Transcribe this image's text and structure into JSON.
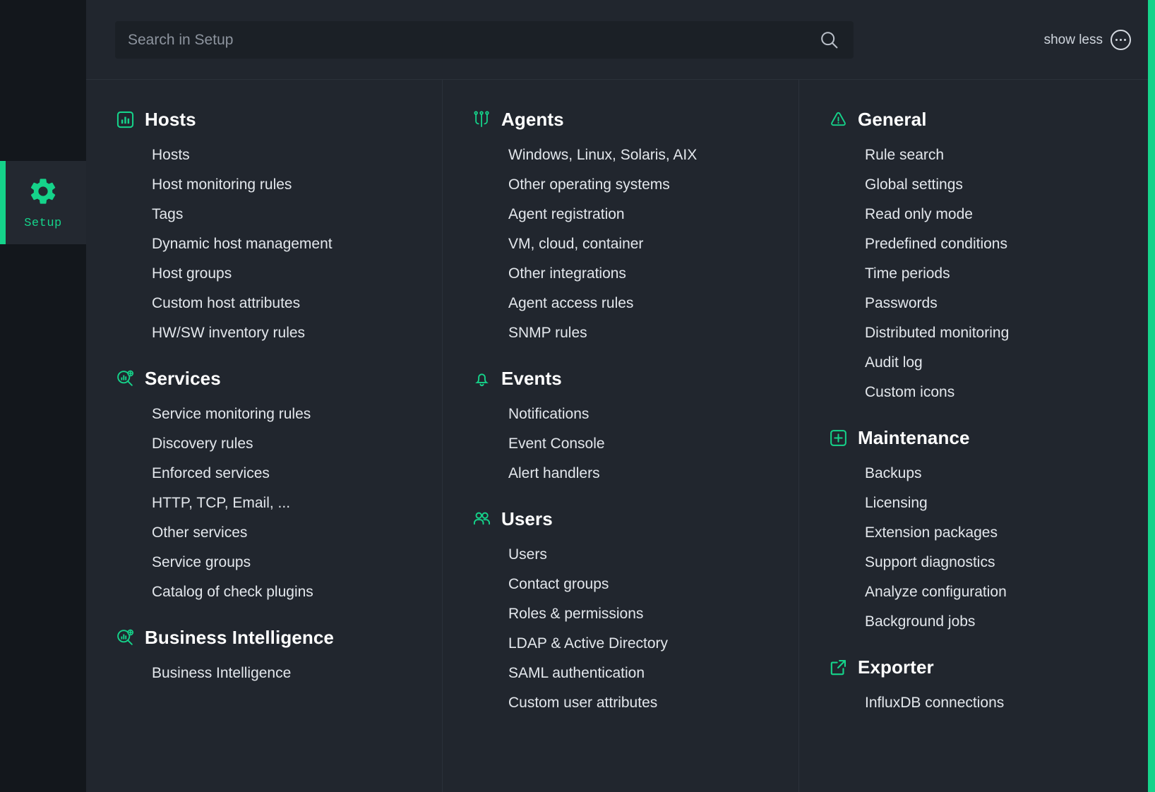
{
  "theme": {
    "accent_green": "#15d38a",
    "rail_bg": "#13171c",
    "panel_bg": "#21262e",
    "search_bg": "#1b2026",
    "text": "#e3e7ec",
    "heading": "#ffffff"
  },
  "sidebar": {
    "items": [
      {
        "label": "Setup",
        "icon": "gear-icon",
        "active": true
      }
    ]
  },
  "header": {
    "search": {
      "placeholder": "Search in Setup",
      "value": "",
      "icon": "search-icon"
    },
    "show_less_label": "show less",
    "more_icon": "ellipsis-circle-icon"
  },
  "columns": [
    {
      "topics": [
        {
          "title": "Hosts",
          "icon": "bar-chart-box-icon",
          "items": [
            "Hosts",
            "Host monitoring rules",
            "Tags",
            "Dynamic host management",
            "Host groups",
            "Custom host attributes",
            "HW/SW inventory rules"
          ]
        },
        {
          "title": "Services",
          "icon": "service-discovery-icon",
          "items": [
            "Service monitoring rules",
            "Discovery rules",
            "Enforced services",
            "HTTP, TCP, Email, ...",
            "Other services",
            "Service groups",
            "Catalog of check plugins"
          ]
        },
        {
          "title": "Business Intelligence",
          "icon": "service-discovery-icon",
          "items": [
            "Business Intelligence"
          ]
        }
      ]
    },
    {
      "topics": [
        {
          "title": "Agents",
          "icon": "agents-pins-icon",
          "items": [
            "Windows, Linux, Solaris, AIX",
            "Other operating systems",
            "Agent registration",
            "VM, cloud, container",
            "Other integrations",
            "Agent access rules",
            "SNMP rules"
          ]
        },
        {
          "title": "Events",
          "icon": "bell-icon",
          "items": [
            "Notifications",
            "Event Console",
            "Alert handlers"
          ]
        },
        {
          "title": "Users",
          "icon": "users-icon",
          "items": [
            "Users",
            "Contact groups",
            "Roles & permissions",
            "LDAP & Active Directory",
            "SAML authentication",
            "Custom user attributes"
          ]
        }
      ]
    },
    {
      "topics": [
        {
          "title": "General",
          "icon": "warning-triangle-icon",
          "items": [
            "Rule search",
            "Global settings",
            "Read only mode",
            "Predefined conditions",
            "Time periods",
            "Passwords",
            "Distributed monitoring",
            "Audit log",
            "Custom icons"
          ]
        },
        {
          "title": "Maintenance",
          "icon": "plus-box-icon",
          "items": [
            "Backups",
            "Licensing",
            "Extension packages",
            "Support diagnostics",
            "Analyze configuration",
            "Background jobs"
          ]
        },
        {
          "title": "Exporter",
          "icon": "external-link-icon",
          "items": [
            "InfluxDB connections"
          ]
        }
      ]
    }
  ]
}
